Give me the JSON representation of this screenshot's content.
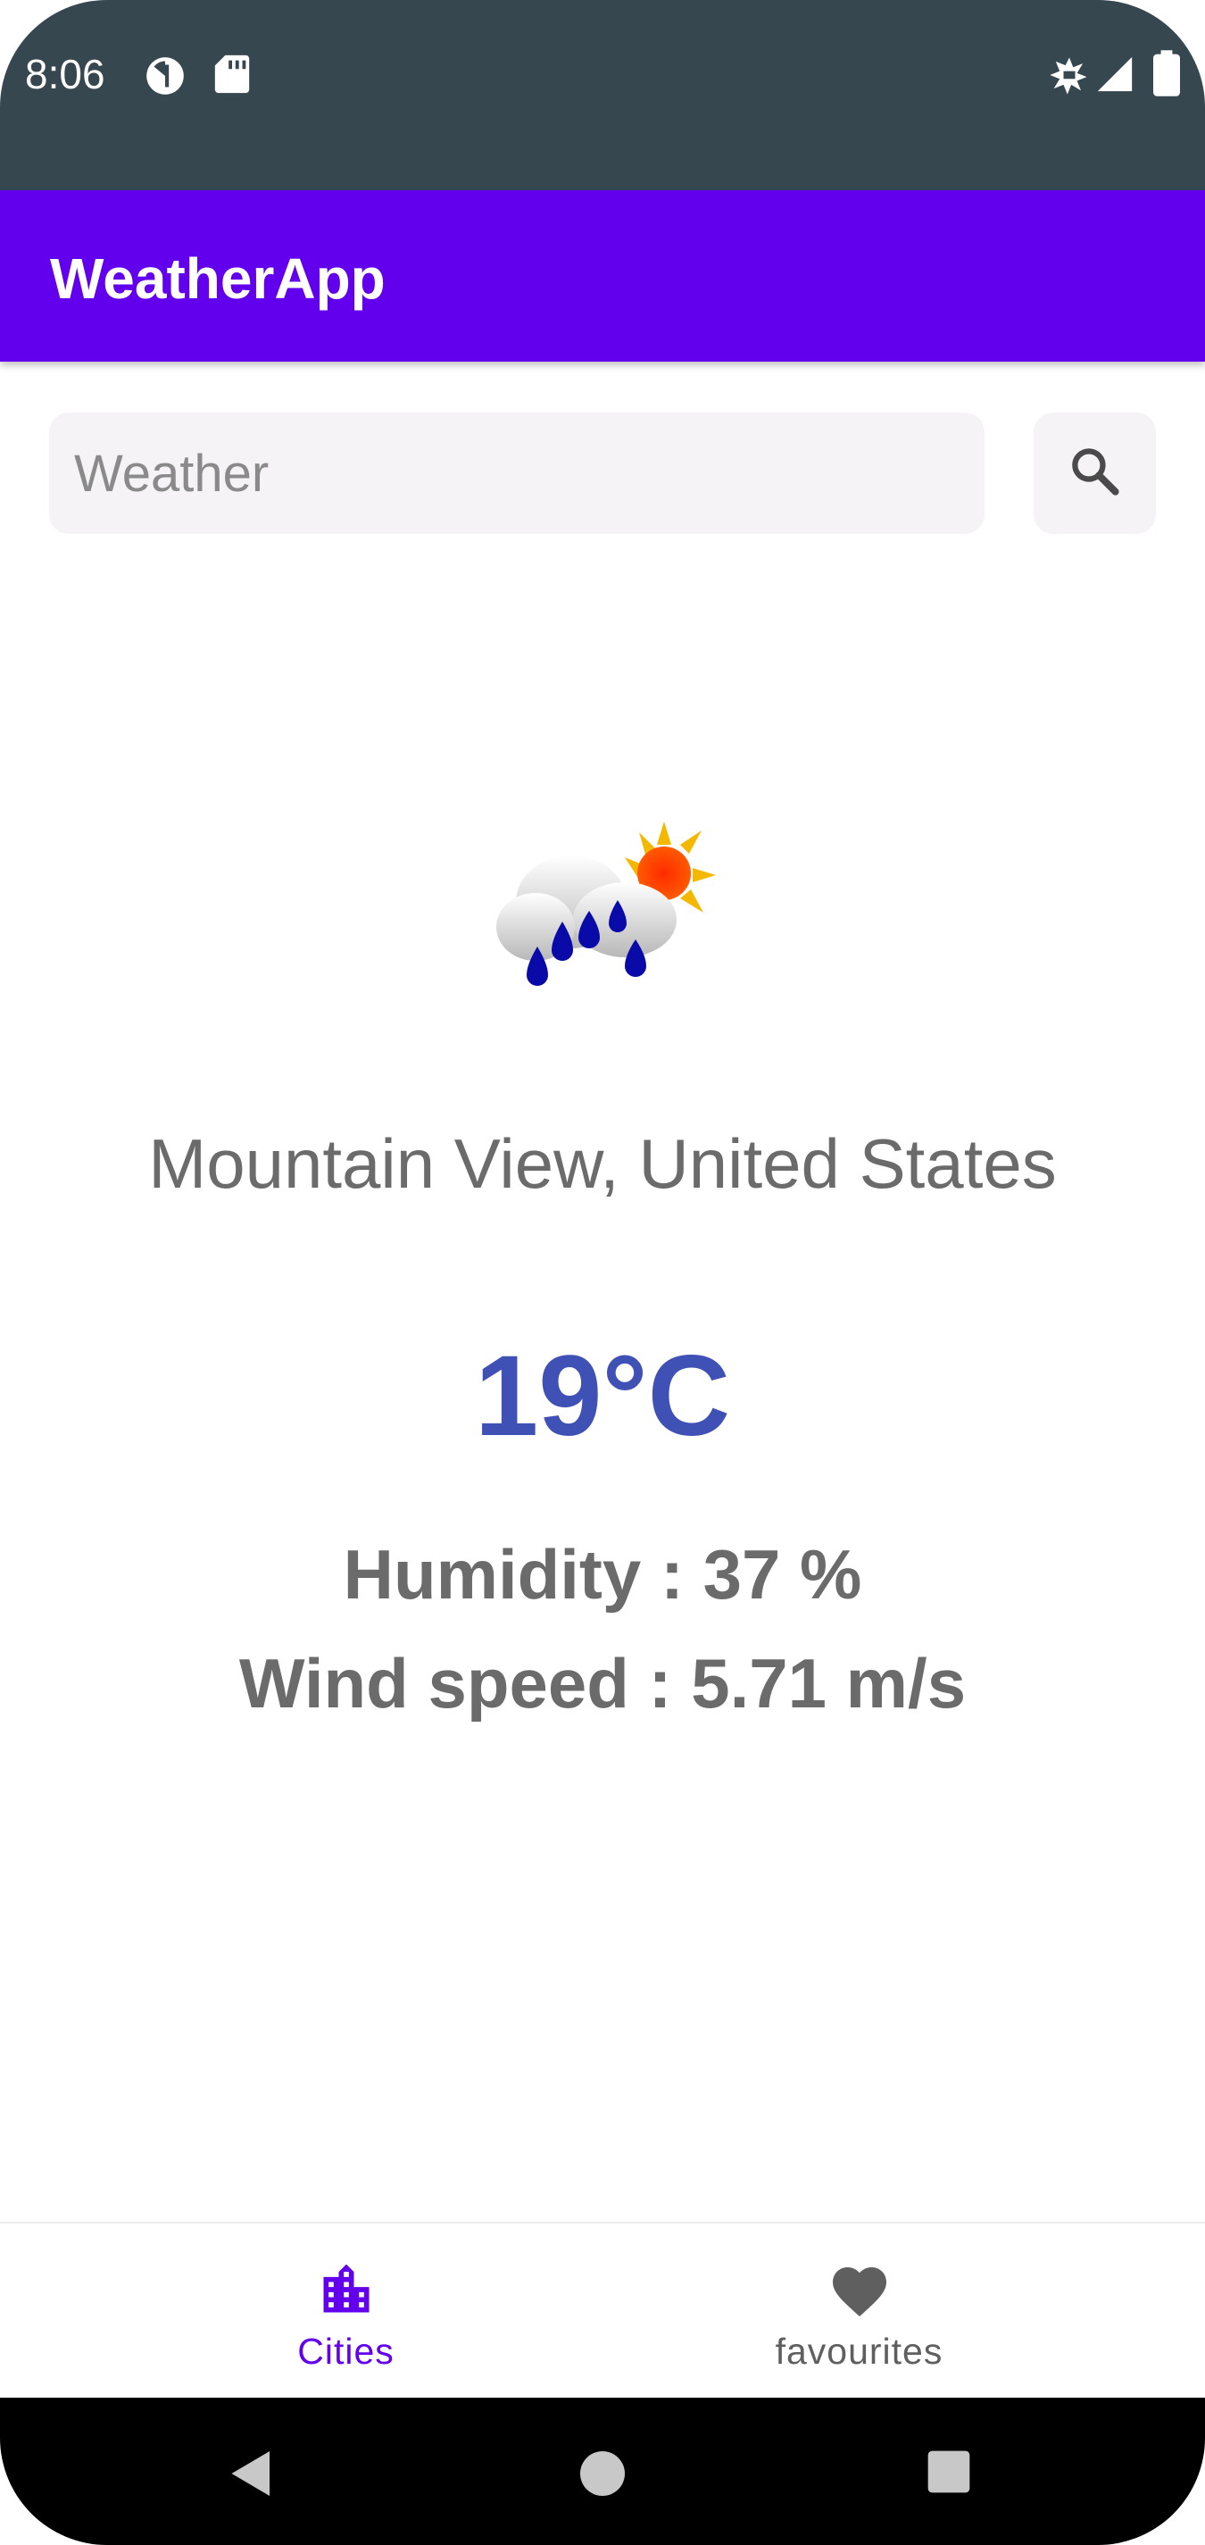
{
  "status_bar": {
    "time": "8:06",
    "icons": [
      "pie-chart-icon",
      "sd-card-icon",
      "signal-icon",
      "cell-signal-icon",
      "battery-icon"
    ]
  },
  "app_bar": {
    "title": "WeatherApp"
  },
  "search": {
    "placeholder": "Weather",
    "value": "",
    "button_icon": "search-icon"
  },
  "weather": {
    "icon": "rain-and-sun-icon",
    "location": "Mountain View, United States",
    "temperature": "19°C",
    "humidity": "Humidity : 37 %",
    "wind_speed": "Wind speed : 5.71 m/s"
  },
  "bottom_nav": {
    "items": [
      {
        "label": "Cities",
        "icon": "city-icon",
        "selected": true
      },
      {
        "label": "favourites",
        "icon": "heart-icon",
        "selected": false
      }
    ]
  },
  "colors": {
    "status_bar": "#37474f",
    "app_bar": "#6200ee",
    "temperature": "#3f51b5",
    "text_secondary": "#6b6b6b",
    "nav_selected": "#6200ee",
    "nav_unselected": "#5f5f5f"
  }
}
